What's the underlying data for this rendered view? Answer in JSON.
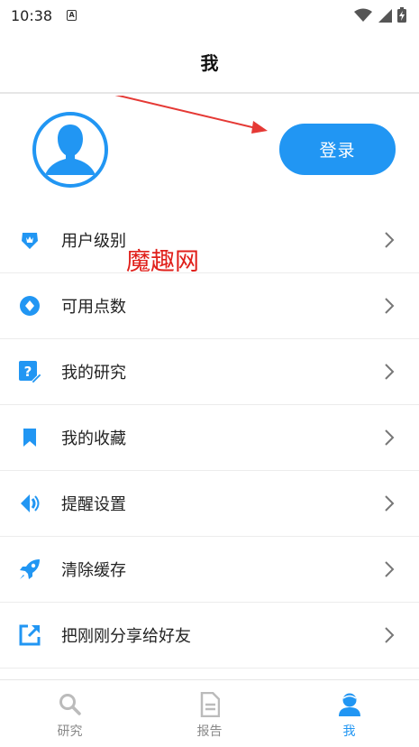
{
  "status_bar": {
    "time": "10:38",
    "indicator": "A"
  },
  "header": {
    "title": "我"
  },
  "profile": {
    "login_label": "登录"
  },
  "watermark": "魔趣网",
  "menu": [
    {
      "label": "用户级别",
      "icon": "badge-icon"
    },
    {
      "label": "可用点数",
      "icon": "points-icon"
    },
    {
      "label": "我的研究",
      "icon": "question-edit-icon"
    },
    {
      "label": "我的收藏",
      "icon": "bookmark-icon"
    },
    {
      "label": "提醒设置",
      "icon": "speaker-icon"
    },
    {
      "label": "清除缓存",
      "icon": "rocket-icon"
    },
    {
      "label": "把刚刚分享给好友",
      "icon": "share-icon"
    }
  ],
  "tabs": [
    {
      "label": "研究",
      "icon": "search-icon",
      "active": false
    },
    {
      "label": "报告",
      "icon": "document-icon",
      "active": false
    },
    {
      "label": "我",
      "icon": "user-icon",
      "active": true
    }
  ],
  "colors": {
    "accent": "#2196f3",
    "watermark": "#e0201b",
    "annotation": "#e53935"
  }
}
